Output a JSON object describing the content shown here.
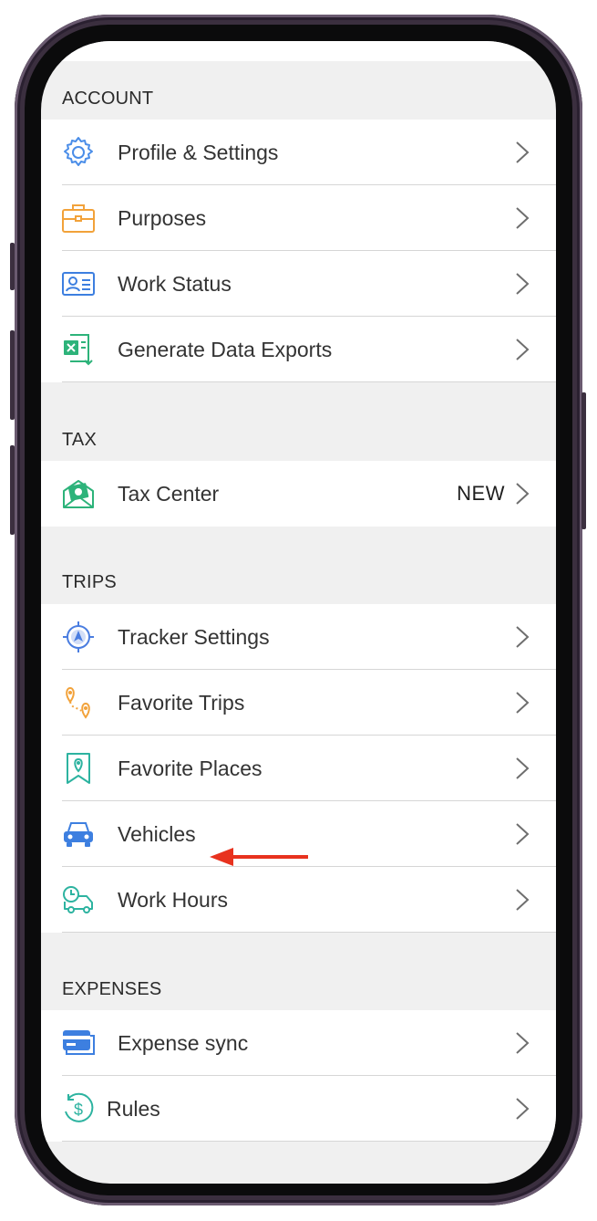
{
  "sections": [
    {
      "header": "ACCOUNT",
      "items": [
        {
          "label": "Profile & Settings",
          "icon": "gear-icon",
          "color": "#4a8de8"
        },
        {
          "label": "Purposes",
          "icon": "briefcase-icon",
          "color": "#f2a23a"
        },
        {
          "label": "Work Status",
          "icon": "id-card-icon",
          "color": "#3d7fe0"
        },
        {
          "label": "Generate Data Exports",
          "icon": "excel-export-icon",
          "color": "#2db37a"
        }
      ]
    },
    {
      "header": "TAX",
      "items": [
        {
          "label": "Tax Center",
          "badge": "NEW",
          "icon": "money-envelope-icon",
          "color": "#2db37a"
        }
      ]
    },
    {
      "header": "TRIPS",
      "items": [
        {
          "label": "Tracker Settings",
          "icon": "location-target-icon",
          "color": "#4a7de0"
        },
        {
          "label": "Favorite Trips",
          "icon": "route-pins-icon",
          "color": "#f2a23a"
        },
        {
          "label": "Favorite Places",
          "icon": "map-pin-icon",
          "color": "#2db3a0"
        },
        {
          "label": "Vehicles",
          "icon": "car-icon",
          "color": "#3d7fe0"
        },
        {
          "label": "Work Hours",
          "icon": "clock-truck-icon",
          "color": "#2db3a0"
        }
      ]
    },
    {
      "header": "EXPENSES",
      "items": [
        {
          "label": "Expense sync",
          "icon": "credit-card-icon",
          "color": "#3d7fe0"
        },
        {
          "label": "Rules",
          "icon": "dollar-cycle-icon",
          "color": "#2db3a0"
        }
      ]
    }
  ],
  "annotation": {
    "target": "Work Hours",
    "color": "#e8321e"
  }
}
